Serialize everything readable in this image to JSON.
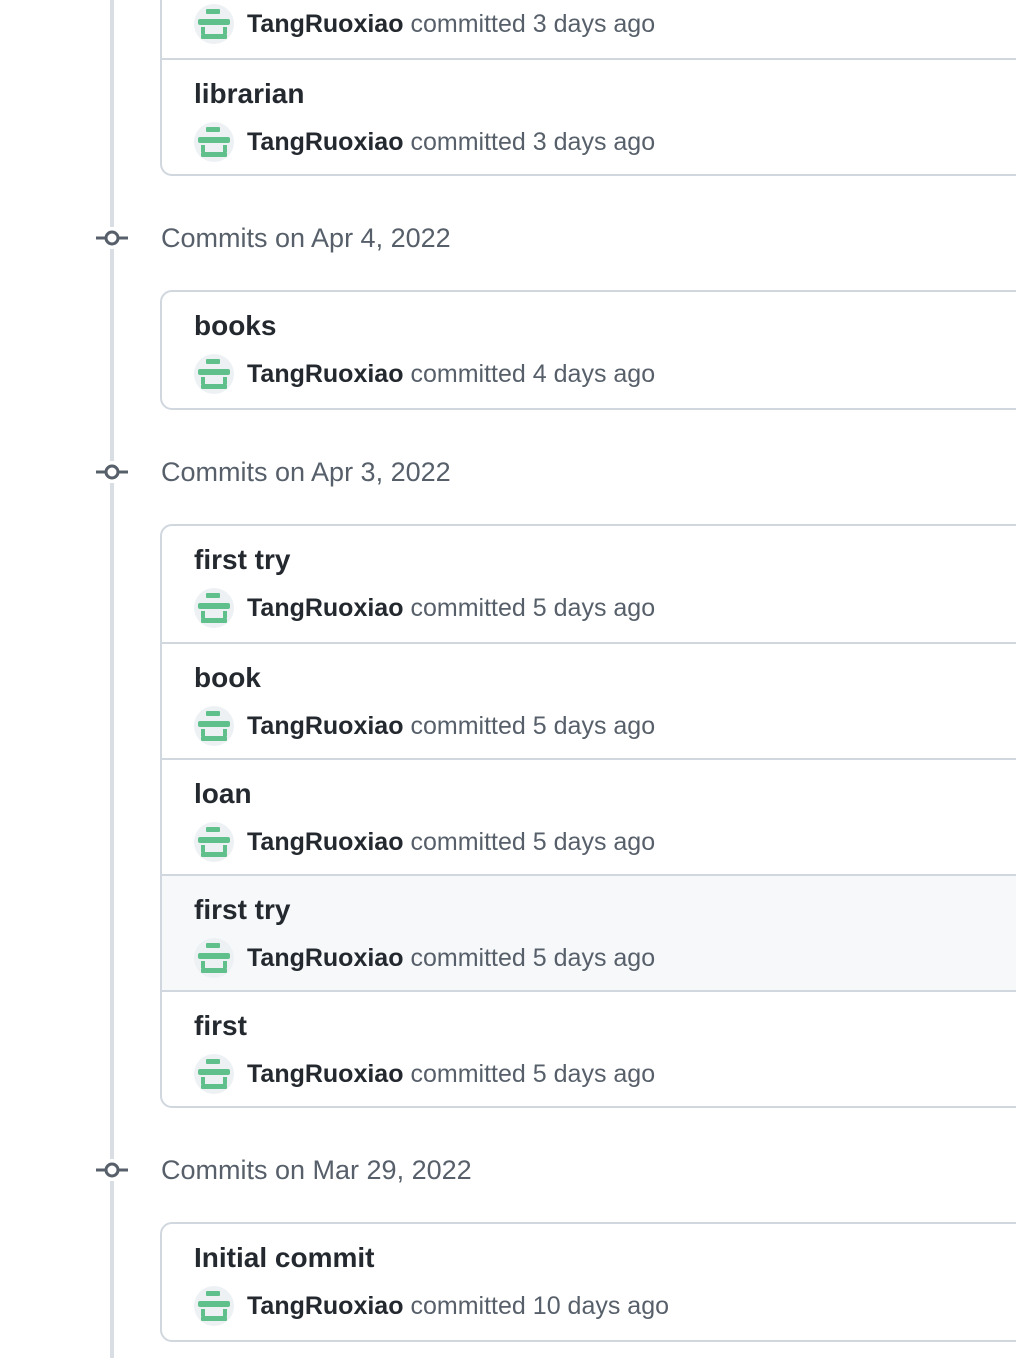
{
  "colors": {
    "timeline": "#d8dee4",
    "avatar_bg": "#eef1f4",
    "avatar_fg": "#5fc08c",
    "highlight_row": "#f6f8fa"
  },
  "icons": {
    "commit_node": "git-commit-icon",
    "avatar": "identicon-avatar"
  },
  "top_list": {
    "commits": [
      {
        "message": "",
        "author": "TangRuoxiao",
        "verb": "committed",
        "when": "3 days ago"
      },
      {
        "message": "librarian",
        "author": "TangRuoxiao",
        "verb": "committed",
        "when": "3 days ago"
      }
    ]
  },
  "groups": [
    {
      "title": "Commits on Apr 4, 2022",
      "commits": [
        {
          "message": "books",
          "author": "TangRuoxiao",
          "verb": "committed",
          "when": "4 days ago"
        }
      ]
    },
    {
      "title": "Commits on Apr 3, 2022",
      "commits": [
        {
          "message": "first try",
          "author": "TangRuoxiao",
          "verb": "committed",
          "when": "5 days ago"
        },
        {
          "message": "book",
          "author": "TangRuoxiao",
          "verb": "committed",
          "when": "5 days ago"
        },
        {
          "message": "loan",
          "author": "TangRuoxiao",
          "verb": "committed",
          "when": "5 days ago"
        },
        {
          "message": "first try",
          "author": "TangRuoxiao",
          "verb": "committed",
          "when": "5 days ago"
        },
        {
          "message": "first",
          "author": "TangRuoxiao",
          "verb": "committed",
          "when": "5 days ago"
        }
      ]
    },
    {
      "title": "Commits on Mar 29, 2022",
      "commits": [
        {
          "message": "Initial commit",
          "author": "TangRuoxiao",
          "verb": "committed",
          "when": "10 days ago"
        }
      ]
    }
  ]
}
